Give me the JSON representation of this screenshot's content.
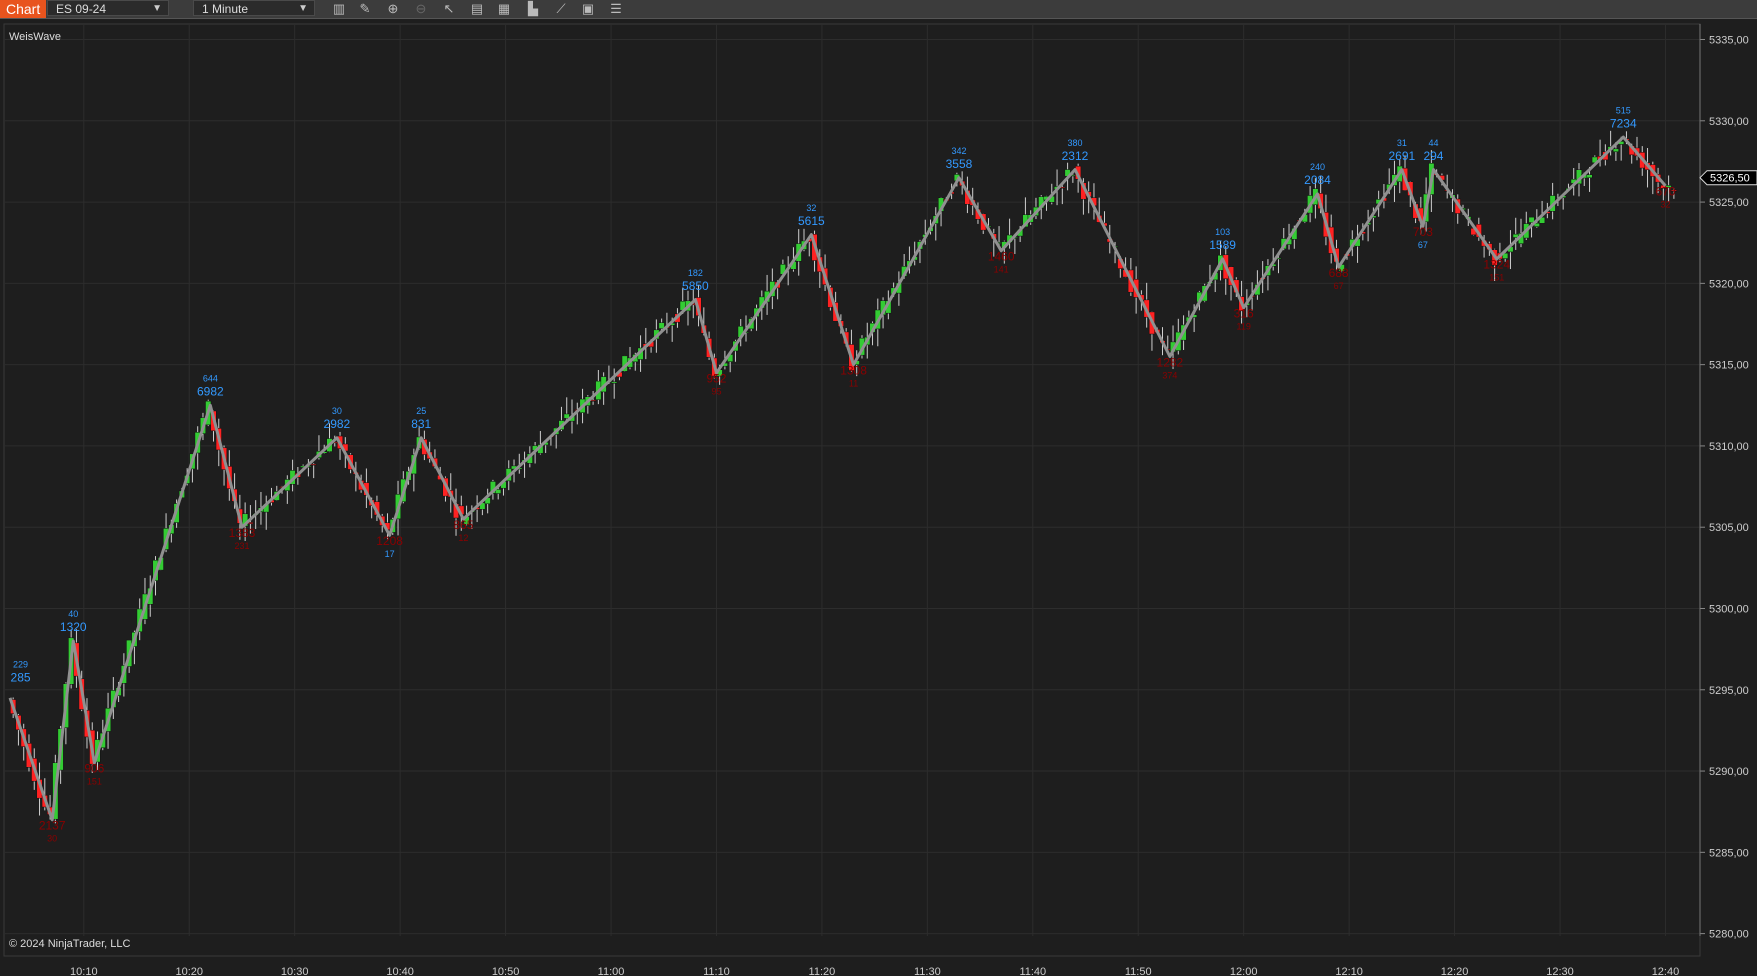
{
  "toolbar": {
    "tab_label": "Chart",
    "instrument": "ES 09-24",
    "interval": "1 Minute",
    "tools": [
      "bar-style-icon",
      "pencil-icon",
      "zoom-in-icon",
      "zoom-out-icon",
      "cursor-icon",
      "data-box-icon",
      "properties-icon",
      "indicators-icon",
      "strategies-icon",
      "chart-trader-icon",
      "list-icon"
    ]
  },
  "indicator_label": "WeisWave",
  "copyright": "© 2024 NinjaTrader, LLC",
  "last_price": "5326,50",
  "colors": {
    "up": "#33cc33",
    "down": "#ff2222",
    "wave": "#909090",
    "blue_label": "#3399ff",
    "red_label": "#8b0000",
    "background": "#1e1e1e",
    "grid": "#2d2d2d"
  },
  "chart_data": {
    "type": "candlestick",
    "instrument": "ES 09-24",
    "interval": "1 Minute",
    "y_ticks": [
      "5280,00",
      "5285,00",
      "5290,00",
      "5295,00",
      "5300,00",
      "5305,00",
      "5310,00",
      "5315,00",
      "5320,00",
      "5325,00",
      "5330,00",
      "5335,00"
    ],
    "y_range": [
      5278.5,
      5337
    ],
    "x_ticks": [
      "10:10",
      "10:20",
      "10:30",
      "10:40",
      "10:50",
      "11:00",
      "11:10",
      "11:20",
      "11:30",
      "11:40",
      "11:50",
      "12:00",
      "12:10",
      "12:20",
      "12:30",
      "12:40"
    ],
    "x_range_minutes": [
      603,
      761
    ],
    "wave_points": [
      [
        603,
        5294.5
      ],
      [
        607,
        5287
      ],
      [
        609,
        5298
      ],
      [
        611,
        5290.5
      ],
      [
        622,
        5312.5
      ],
      [
        625,
        5305
      ],
      [
        634,
        5310.5
      ],
      [
        639,
        5304.5
      ],
      [
        642,
        5310.5
      ],
      [
        646,
        5305.5
      ],
      [
        668,
        5319
      ],
      [
        670,
        5314.5
      ],
      [
        679,
        5323
      ],
      [
        683,
        5315
      ],
      [
        693,
        5326.5
      ],
      [
        697,
        5322
      ],
      [
        704,
        5327
      ],
      [
        713,
        5315.5
      ],
      [
        718,
        5321.5
      ],
      [
        720,
        5318.5
      ],
      [
        727,
        5325.5
      ],
      [
        729,
        5321
      ],
      [
        735,
        5327
      ],
      [
        737,
        5323.5
      ],
      [
        738,
        5327
      ],
      [
        744,
        5321.5
      ],
      [
        756,
        5329
      ],
      [
        760,
        5326
      ]
    ],
    "wave_labels": [
      {
        "t": 604,
        "p": 5295.5,
        "volume": "285",
        "count": "229",
        "color": "blue"
      },
      {
        "t": 607,
        "p": 5286.4,
        "volume": "2137",
        "count": "30",
        "color": "red"
      },
      {
        "t": 609,
        "p": 5298.6,
        "volume": "1320",
        "count": "40",
        "color": "blue"
      },
      {
        "t": 611,
        "p": 5289.9,
        "volume": "906",
        "count": "151",
        "color": "red"
      },
      {
        "t": 622,
        "p": 5313.1,
        "volume": "6982",
        "count": "644",
        "color": "blue"
      },
      {
        "t": 625,
        "p": 5304.4,
        "volume": "1383",
        "count": "231",
        "color": "red"
      },
      {
        "t": 634,
        "p": 5311.1,
        "volume": "2982",
        "count": "30",
        "color": "blue"
      },
      {
        "t": 639,
        "p": 5303.9,
        "volume": "1208",
        "count": "17",
        "color": "red",
        "count_color": "blue"
      },
      {
        "t": 642,
        "p": 5311.1,
        "volume": "831",
        "count": "25",
        "color": "blue"
      },
      {
        "t": 646,
        "p": 5304.9,
        "volume": "865",
        "count": "12",
        "color": "red"
      },
      {
        "t": 668,
        "p": 5319.6,
        "volume": "5850",
        "count": "182",
        "color": "blue"
      },
      {
        "t": 670,
        "p": 5313.9,
        "volume": "952",
        "count": "95",
        "color": "red"
      },
      {
        "t": 679,
        "p": 5323.6,
        "volume": "5615",
        "count": "32",
        "color": "blue"
      },
      {
        "t": 683,
        "p": 5314.4,
        "volume": "1308",
        "count": "11",
        "color": "red"
      },
      {
        "t": 693,
        "p": 5327.1,
        "volume": "3558",
        "count": "342",
        "color": "blue"
      },
      {
        "t": 697,
        "p": 5321.4,
        "volume": "1460",
        "count": "141",
        "color": "red"
      },
      {
        "t": 704,
        "p": 5327.6,
        "volume": "2312",
        "count": "380",
        "color": "blue"
      },
      {
        "t": 713,
        "p": 5314.9,
        "volume": "1282",
        "count": "374",
        "color": "red"
      },
      {
        "t": 718,
        "p": 5322.1,
        "volume": "1589",
        "count": "103",
        "color": "blue"
      },
      {
        "t": 720,
        "p": 5317.9,
        "volume": "316",
        "count": "119",
        "color": "red"
      },
      {
        "t": 727,
        "p": 5326.1,
        "volume": "2084",
        "count": "240",
        "color": "blue"
      },
      {
        "t": 729,
        "p": 5320.4,
        "volume": "688",
        "count": "67",
        "color": "red"
      },
      {
        "t": 735,
        "p": 5327.6,
        "volume": "2691",
        "count": "31",
        "color": "blue"
      },
      {
        "t": 737,
        "p": 5322.9,
        "volume": "703",
        "count": "67",
        "color": "red",
        "count_color": "blue"
      },
      {
        "t": 738,
        "p": 5327.6,
        "volume": "294",
        "count": "44",
        "color": "blue"
      },
      {
        "t": 744,
        "p": 5320.9,
        "volume": "1324",
        "count": "151",
        "color": "red"
      },
      {
        "t": 756,
        "p": 5329.6,
        "volume": "7234",
        "count": "515",
        "color": "blue"
      },
      {
        "t": 760,
        "p": 5325.4,
        "volume": "670",
        "count": "32",
        "color": "red"
      }
    ]
  }
}
